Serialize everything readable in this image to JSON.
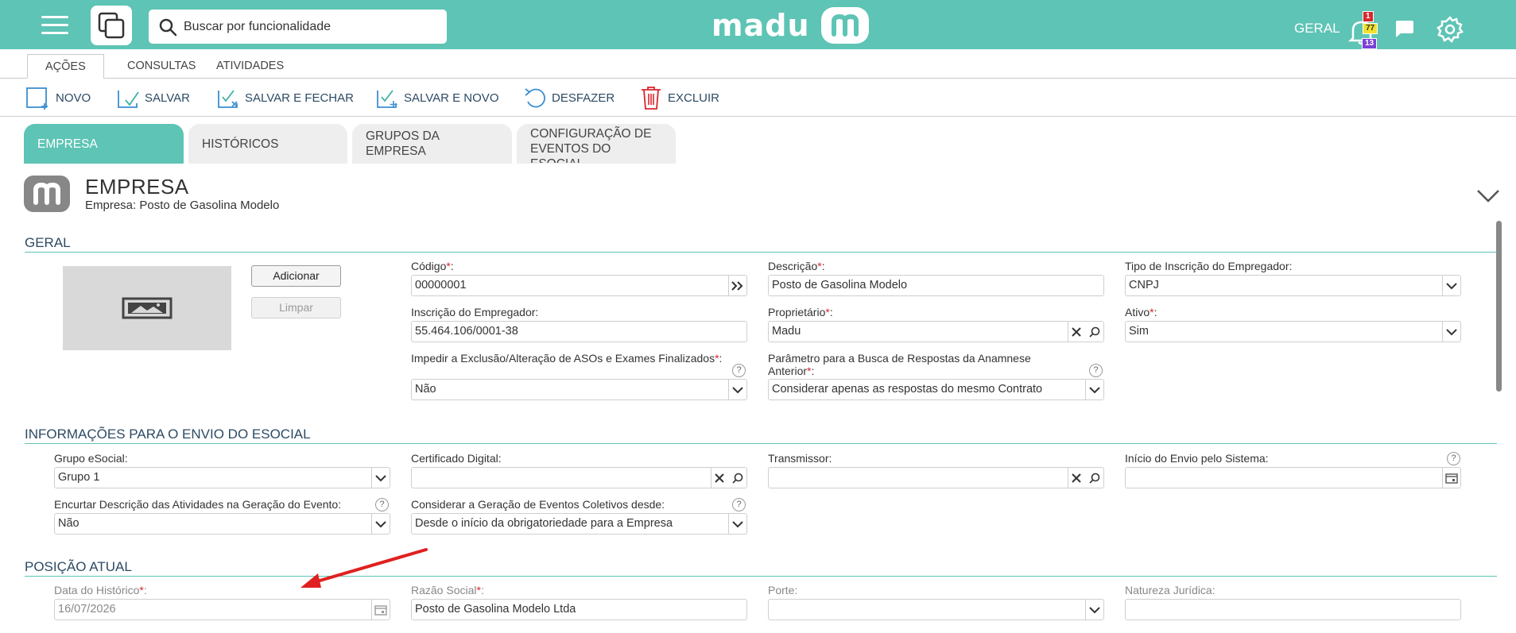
{
  "topbar": {
    "search_placeholder": "Buscar por funcionalidade",
    "logo_text": "madu",
    "scope_label": "GERAL",
    "notifications": {
      "red": "1",
      "yellow": "77",
      "purple": "13"
    },
    "brand_color": "#5ec4b5"
  },
  "menu_tabs": [
    "Ações",
    "Consultas",
    "Atividades"
  ],
  "toolbar": {
    "novo": "NOVO",
    "salvar": "SALVAR",
    "salvar_fechar": "SALVAR E FECHAR",
    "salvar_novo": "SALVAR E NOVO",
    "desfazer": "DESFAZER",
    "excluir": "EXCLUIR"
  },
  "page_tabs": [
    "EMPRESA",
    "HISTÓRICOS",
    "GRUPOS DA EMPRESA",
    "CONFIGURAÇÃO DE EVENTOS DO ESOCIAL"
  ],
  "header": {
    "title": "EMPRESA",
    "subtitle": "Empresa: Posto de Gasolina Modelo"
  },
  "sections": {
    "geral": "GERAL",
    "esocial": "INFORMAÇÕES PARA O ENVIO DO ESOCIAL",
    "posicao": "POSIÇÃO ATUAL"
  },
  "buttons": {
    "adicionar": "Adicionar",
    "limpar": "Limpar"
  },
  "geral": {
    "codigo": {
      "label": "Código",
      "value": "00000001"
    },
    "descricao": {
      "label": "Descrição",
      "value": "Posto de Gasolina Modelo"
    },
    "tipo_inscricao": {
      "label": "Tipo de Inscrição do Empregador:",
      "value": "CNPJ"
    },
    "inscricao": {
      "label": "Inscrição do Empregador:",
      "value": "55.464.106/0001-38"
    },
    "proprietario": {
      "label": "Proprietário",
      "value": "Madu"
    },
    "ativo": {
      "label": "Ativo",
      "value": "Sim"
    },
    "impedir": {
      "label": "Impedir a Exclusão/Alteração de ASOs e Exames Finalizados",
      "value": "Não"
    },
    "parametro": {
      "label": "Parâmetro para a Busca de Respostas da Anamnese Anterior",
      "value": "Considerar apenas as respostas do mesmo Contrato"
    }
  },
  "esocial": {
    "grupo": {
      "label": "Grupo eSocial:",
      "value": "Grupo 1"
    },
    "certificado": {
      "label": "Certificado Digital:",
      "value": ""
    },
    "transmissor": {
      "label": "Transmissor:",
      "value": ""
    },
    "inicio_envio": {
      "label": "Início do Envio pelo Sistema:",
      "value": ""
    },
    "encurtar": {
      "label": "Encurtar Descrição das Atividades na Geração do Evento:",
      "value": "Não"
    },
    "considerar": {
      "label": "Considerar a Geração de Eventos Coletivos desde:",
      "value": "Desde o início da obrigatoriedade para a Empresa"
    }
  },
  "posicao": {
    "data_historico": {
      "label": "Data do Histórico",
      "value": "16/07/2026"
    },
    "razao_social": {
      "label": "Razão Social",
      "value": "Posto de Gasolina Modelo Ltda"
    },
    "porte": {
      "label": "Porte:",
      "value": ""
    },
    "natureza": {
      "label": "Natureza Jurídica:",
      "value": ""
    }
  },
  "colon": ":",
  "asterisk": "*"
}
